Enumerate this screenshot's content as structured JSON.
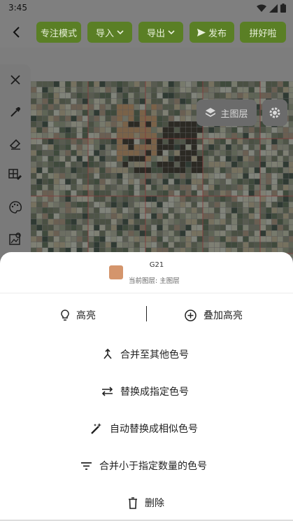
{
  "status": {
    "time": "3:45"
  },
  "toolbar": {
    "focus": "专注模式",
    "import": "导入",
    "export": "导出",
    "publish": "发布",
    "pinhaola": "拼好啦"
  },
  "canvas": {
    "layer_button": "主图层"
  },
  "sheet": {
    "color_code": "G21",
    "color_hex": "#d4956c",
    "current_layer": "当前图层: 主图层",
    "highlight": "高亮",
    "overlay_highlight": "叠加高亮",
    "actions": [
      "合并至其他色号",
      "替换成指定色号",
      "自动替换成相似色号",
      "合并小于指定数量的色号",
      "删除"
    ]
  }
}
